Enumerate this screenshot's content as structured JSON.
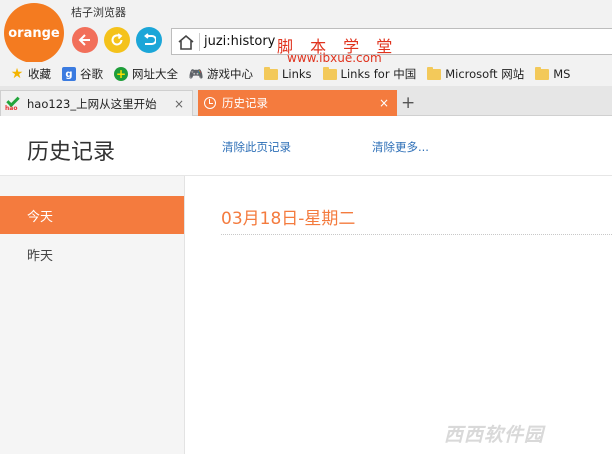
{
  "app": {
    "logo_text": "orange",
    "title": "桔子浏览器",
    "colors": {
      "accent": "#f47b3e",
      "logo": "#f47b20",
      "back": "#f26f5a",
      "refresh": "#f4c21b",
      "restore": "#1ba6d8",
      "link": "#2d6fb7"
    }
  },
  "nav": {
    "back_icon": "back-arrow-icon",
    "refresh_icon": "refresh-icon",
    "restore_icon": "restore-icon"
  },
  "address": {
    "home_icon": "home-icon",
    "url": "juzi:history"
  },
  "watermark": {
    "line1": "脚 本 学 堂",
    "line2": "www.jbxue.com",
    "footer": "西西软件园"
  },
  "bookmarks": [
    {
      "label": "收藏",
      "icon": "star-icon"
    },
    {
      "label": "谷歌",
      "icon": "google-icon"
    },
    {
      "label": "网址大全",
      "icon": "plus-icon"
    },
    {
      "label": "游戏中心",
      "icon": "gamepad-icon"
    },
    {
      "label": "Links",
      "icon": "folder-icon"
    },
    {
      "label": "Links for 中国",
      "icon": "folder-icon"
    },
    {
      "label": "Microsoft 网站",
      "icon": "folder-icon"
    },
    {
      "label": "MS",
      "icon": "folder-icon"
    }
  ],
  "tabs": [
    {
      "label": "hao123_上网从这里开始",
      "icon": "hao123-icon",
      "close": "×"
    },
    {
      "label": "历史记录",
      "icon": "clock-icon",
      "close": "×"
    }
  ],
  "new_tab": "+",
  "history": {
    "title": "历史记录",
    "clear_page": "清除此页记录",
    "clear_more": "清除更多...",
    "sidebar": {
      "today": "今天",
      "yesterday": "昨天"
    },
    "date_heading": "03月18日-星期二"
  }
}
